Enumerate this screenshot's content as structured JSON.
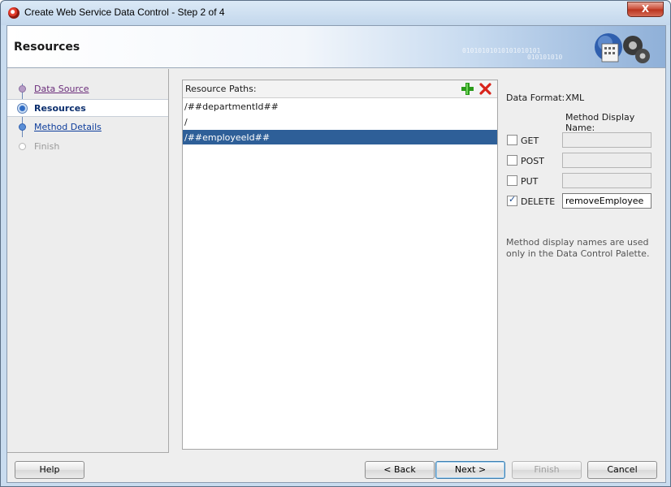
{
  "window": {
    "title": "Create Web Service Data Control - Step 2 of 4",
    "close_glyph": "X"
  },
  "banner": {
    "title": "Resources",
    "binary_text": "01010101010101010101",
    "binary_text2": "010101010"
  },
  "steps": [
    {
      "label": "Data Source",
      "state": "visited"
    },
    {
      "label": "Resources",
      "state": "current"
    },
    {
      "label": "Method Details",
      "state": "link"
    },
    {
      "label": "Finish",
      "state": "disabled"
    }
  ],
  "resources": {
    "header": "Resource Paths:",
    "paths": [
      "/##departmentId##",
      "/",
      "/##employeeId##"
    ],
    "selected_index": 2
  },
  "format": {
    "label": "Data Format:",
    "value": "XML",
    "method_name_header": "Method Display Name:"
  },
  "methods": [
    {
      "label": "GET",
      "checked": false,
      "value": ""
    },
    {
      "label": "POST",
      "checked": false,
      "value": ""
    },
    {
      "label": "PUT",
      "checked": false,
      "value": ""
    },
    {
      "label": "DELETE",
      "checked": true,
      "value": "removeEmployee"
    }
  ],
  "note": "Method display names are used only in the Data Control Palette.",
  "buttons": {
    "help": "Help",
    "back": "< Back",
    "next": "Next >",
    "finish": "Finish",
    "cancel": "Cancel"
  },
  "colors": {
    "selection": "#2e5f98",
    "add_icon": "#2a9a1a",
    "delete_icon": "#d8231a"
  },
  "icons": {
    "add": "add-icon",
    "delete": "delete-icon",
    "app": "oracle-jdev-icon",
    "banner": "web-service-graphic"
  }
}
